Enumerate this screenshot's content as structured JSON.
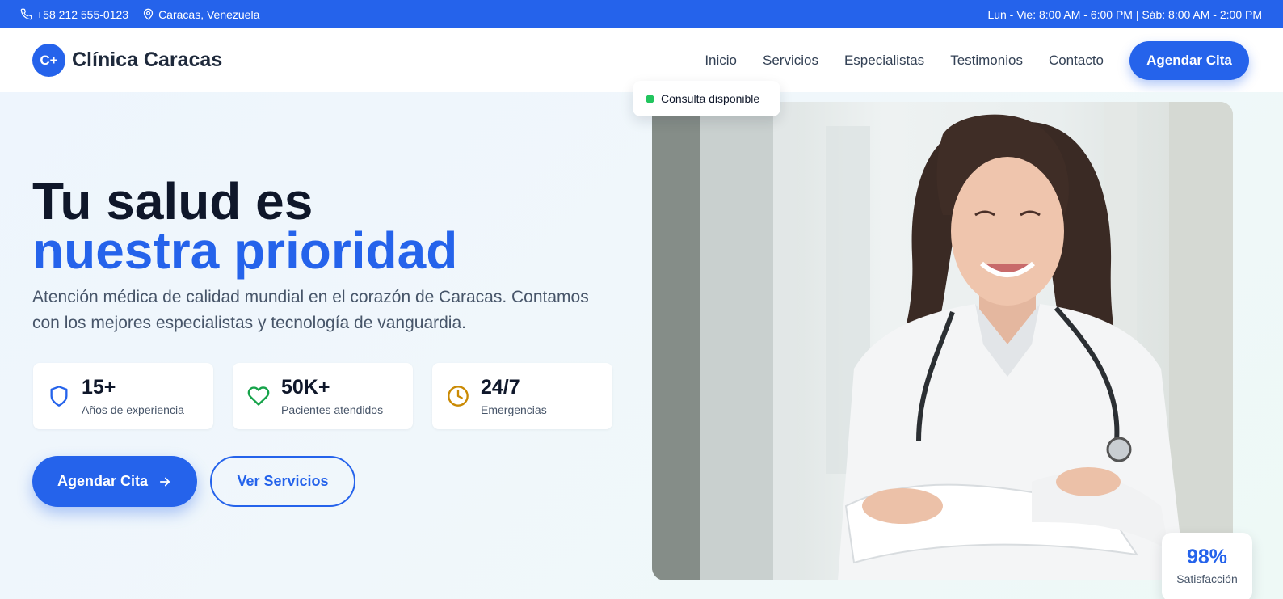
{
  "topbar": {
    "phone": "+58 212 555-0123",
    "location": "Caracas, Venezuela",
    "hours": "Lun - Vie: 8:00 AM - 6:00 PM | Sáb: 8:00 AM - 2:00 PM",
    "phone_icon": "phone-icon",
    "location_icon": "map-pin-icon"
  },
  "header": {
    "logo_text": "C+",
    "brand": "Clínica Caracas",
    "nav": [
      "Inicio",
      "Servicios",
      "Especialistas",
      "Testimonios",
      "Contacto"
    ],
    "cta": "Agendar Cita"
  },
  "hero": {
    "title_line1": "Tu salud es",
    "title_line2": "nuestra prioridad",
    "description": "Atención médica de calidad mundial en el corazón de Caracas. Contamos con los mejores especialistas y tecnología de vanguardia.",
    "stats": [
      {
        "value": "15+",
        "label": "Años de experiencia",
        "icon": "shield-icon",
        "color": "#2563eb"
      },
      {
        "value": "50K+",
        "label": "Pacientes atendidos",
        "icon": "heart-icon",
        "color": "#16a34a"
      },
      {
        "value": "24/7",
        "label": "Emergencias",
        "icon": "clock-icon",
        "color": "#ca8a04"
      }
    ],
    "primary_button": "Agendar Cita",
    "secondary_button": "Ver Servicios",
    "availability_badge": "Consulta disponible",
    "satisfaction_value": "98%",
    "satisfaction_label": "Satisfacción"
  },
  "colors": {
    "accent": "#2563eb",
    "available_dot": "#22c55e"
  }
}
